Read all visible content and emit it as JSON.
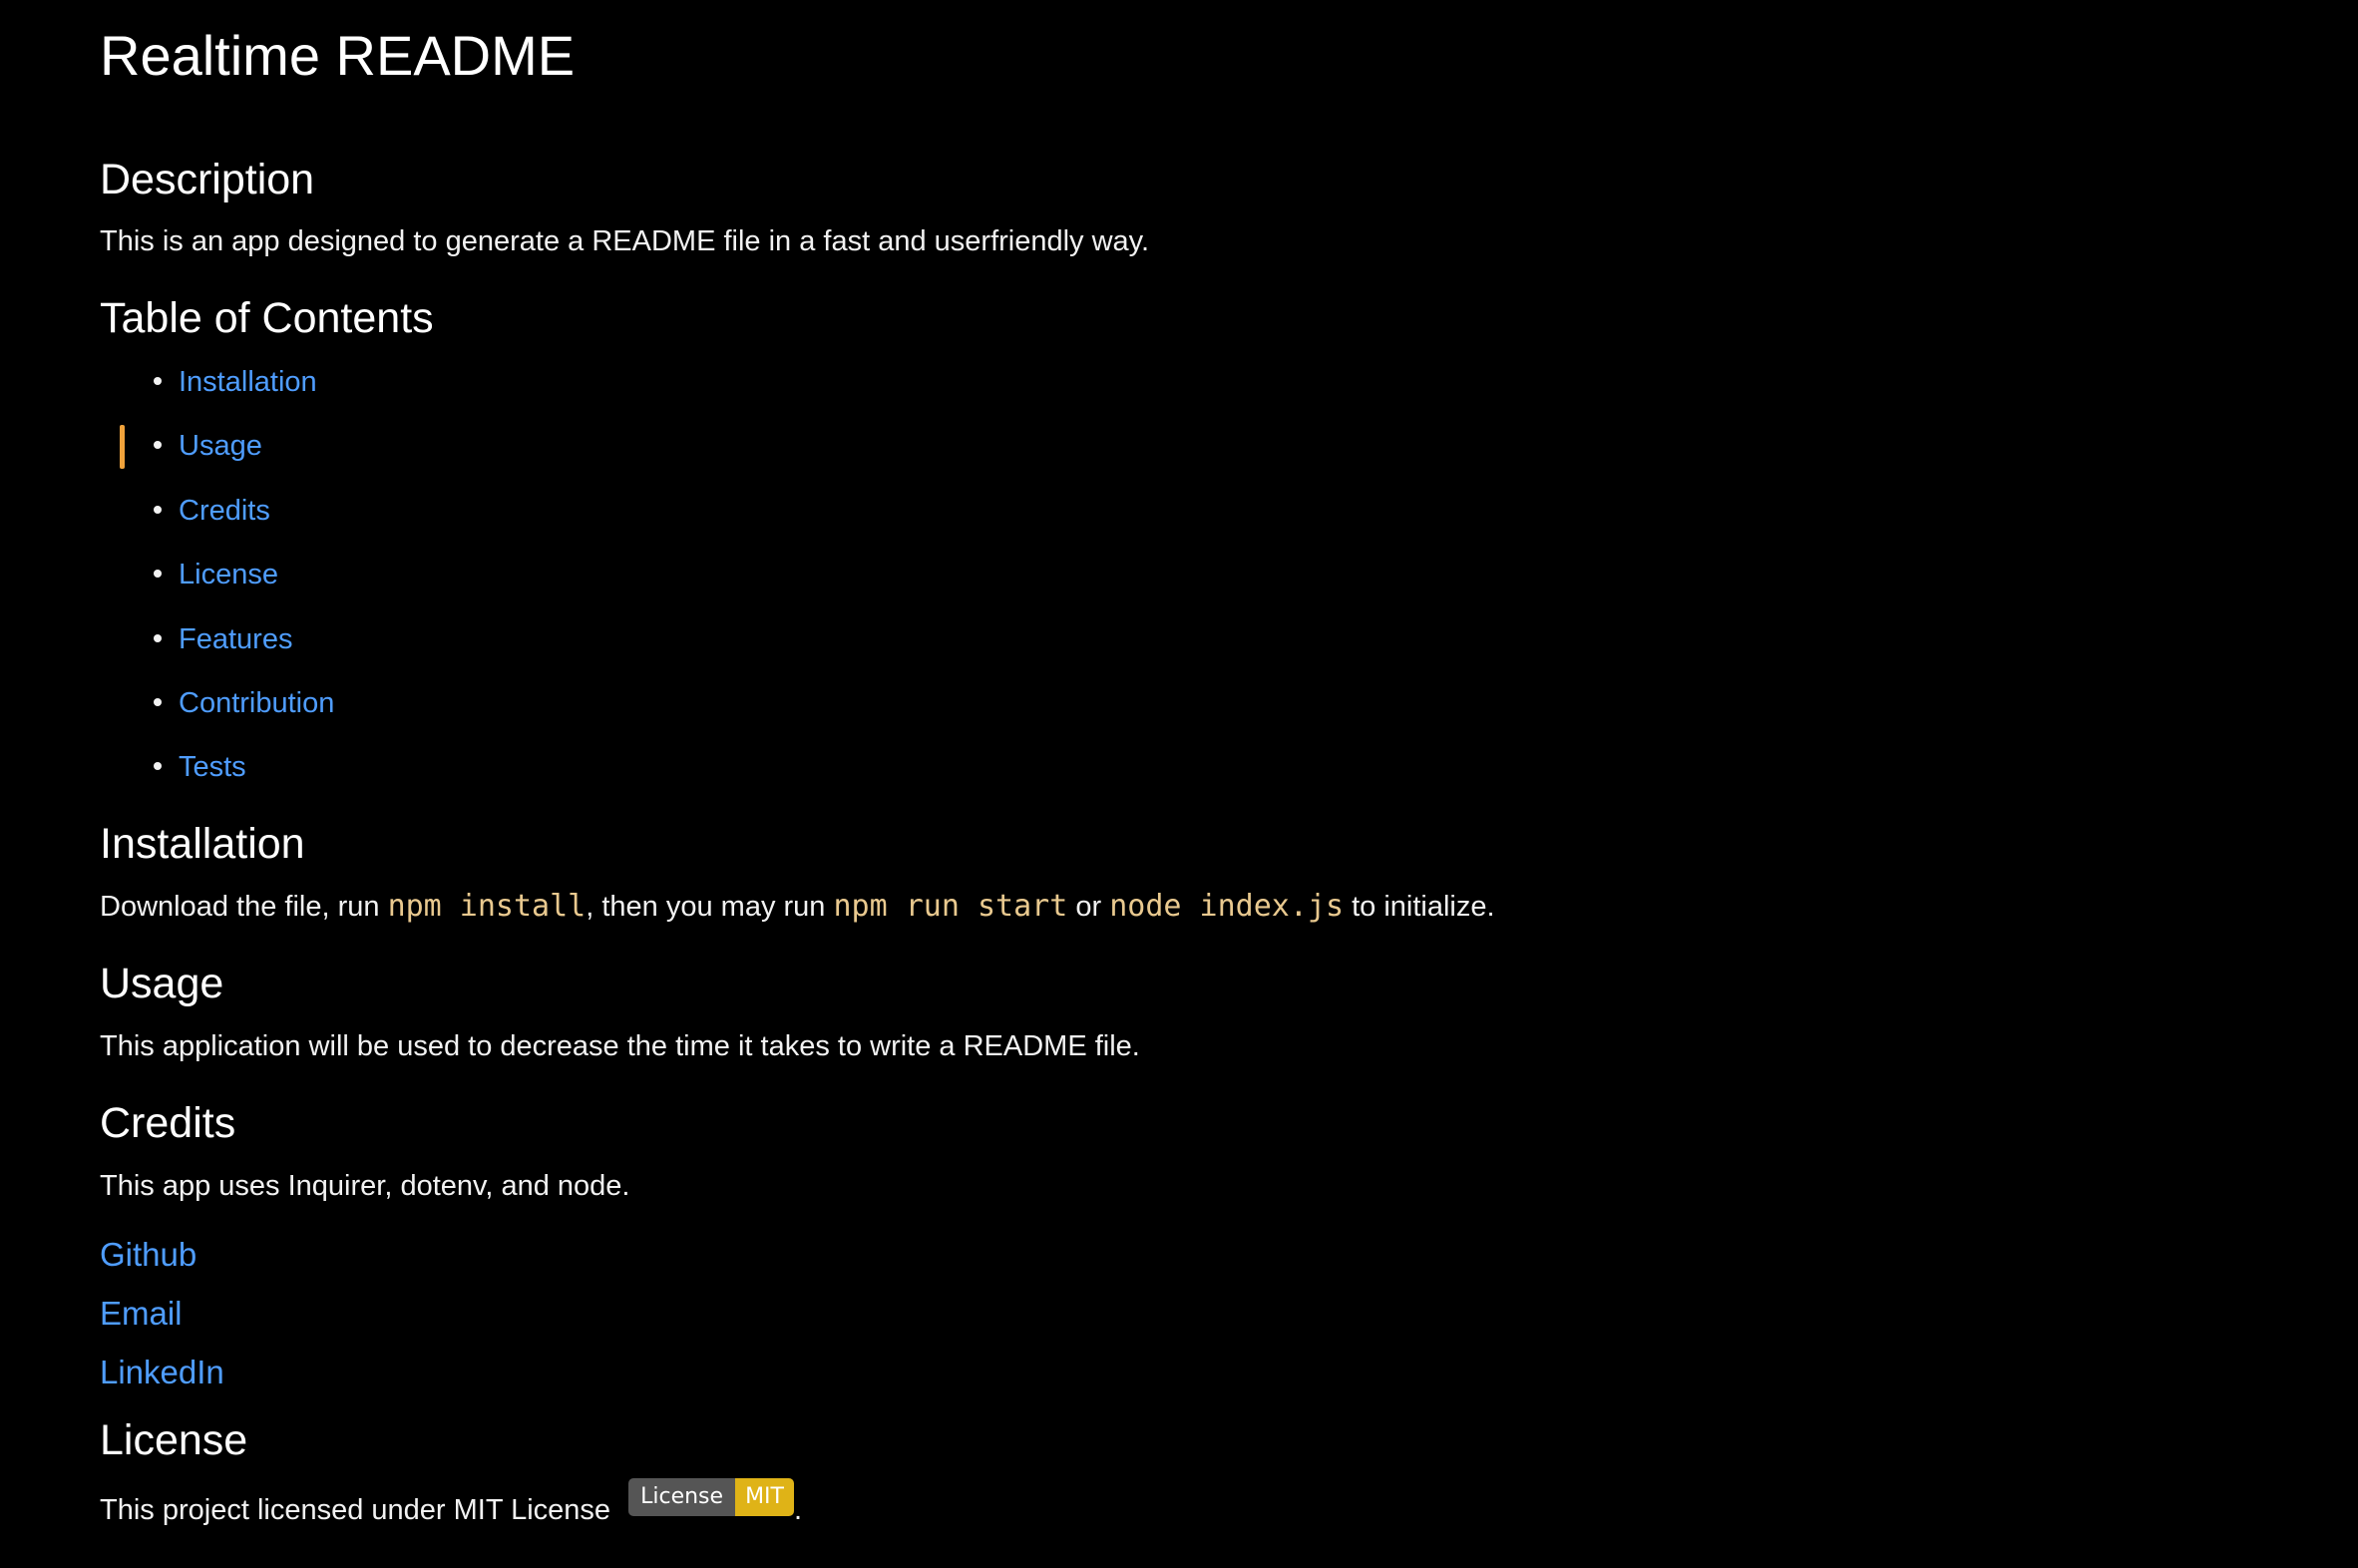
{
  "title": "Realtime README",
  "description": {
    "heading": "Description",
    "text": "This is an app designed to generate a README file in a fast and userfriendly way."
  },
  "toc": {
    "heading": "Table of Contents",
    "items": [
      "Installation",
      "Usage",
      "Credits",
      "License",
      "Features",
      "Contribution",
      "Tests"
    ]
  },
  "installation": {
    "heading": "Installation",
    "text_1": "Download the file, run ",
    "code_1": "npm install",
    "text_2": ", then you may run ",
    "code_2": "npm run start",
    "text_3": " or ",
    "code_3": "node index.js",
    "text_4": " to initialize."
  },
  "usage": {
    "heading": "Usage",
    "text": "This application will be used to decrease the time it takes to write a README file."
  },
  "credits": {
    "heading": "Credits",
    "text": "This app uses Inquirer, dotenv, and node.",
    "links": [
      "Github",
      "Email",
      "LinkedIn"
    ]
  },
  "license": {
    "heading": "License",
    "text": "This project licensed under MIT License ",
    "badge_left": "License",
    "badge_right": "MIT",
    "trailing": "."
  },
  "colors": {
    "background": "#000000",
    "link": "#4f9dff",
    "code": "#e9c98f",
    "marker": "#f0a23b",
    "badge_left": "#555555",
    "badge_right": "#dfb317"
  }
}
